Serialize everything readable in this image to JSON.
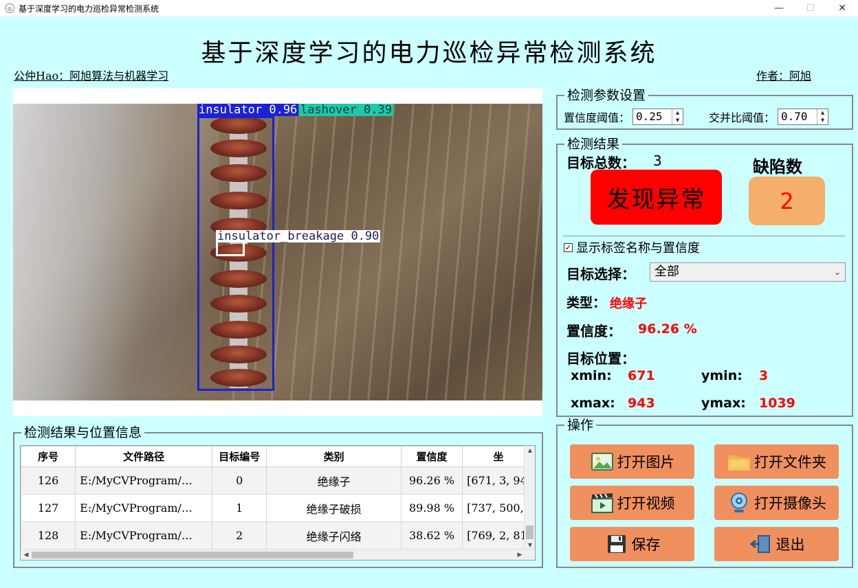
{
  "window": {
    "title": "基于深度学习的电力巡检异常检测系统"
  },
  "header": {
    "main_title": "基于深度学习的电力巡检异常检测系统",
    "left_note": "公仲Hao：阿旭算法与机器学习",
    "right_note": "作者：阿旭"
  },
  "image_view": {
    "detections": [
      {
        "label": "insulator 0.96",
        "color": "#1a22d6"
      },
      {
        "label": "lashover 0.39",
        "color": "#1cc9a8"
      },
      {
        "label": "insulator_breakage 0.90",
        "color": "#ffffff"
      }
    ]
  },
  "params": {
    "title": "检测参数设置",
    "conf_label": "置信度阈值：",
    "conf_value": "0.25",
    "iou_label": "交并比阈值：",
    "iou_value": "0.70"
  },
  "results": {
    "title": "检测结果",
    "total_label": "目标总数：",
    "total_value": "3",
    "defect_label": "缺陷数",
    "abnormal_text": "发现异常",
    "defect_value": "2",
    "show_labels_text": "显示标签名称与置信度",
    "target_select_label": "目标选择：",
    "target_select_value": "全部",
    "type_label": "类型：",
    "type_value": "绝缘子",
    "conf_label": "置信度：",
    "conf_value": "96.26 %",
    "pos_label": "目标位置：",
    "xmin_label": "xmin:",
    "xmin_value": "671",
    "ymin_label": "ymin:",
    "ymin_value": "3",
    "xmax_label": "xmax:",
    "xmax_value": "943",
    "ymax_label": "ymax:",
    "ymax_value": "1039"
  },
  "table": {
    "title": "检测结果与位置信息",
    "headers": [
      "序号",
      "文件路径",
      "目标编号",
      "类别",
      "置信度",
      "坐"
    ],
    "rows": [
      [
        "126",
        "E:/MyCVProgram/…",
        "0",
        "绝缘子",
        "96.26 %",
        "[671, 3, 94"
      ],
      [
        "127",
        "E:/MyCVProgram/…",
        "1",
        "绝缘子破损",
        "89.98 %",
        "[737, 500, 8"
      ],
      [
        "128",
        "E:/MyCVProgram/…",
        "2",
        "绝缘子闪络",
        "38.62 %",
        "[769, 2, 81"
      ]
    ]
  },
  "actions": {
    "title": "操作",
    "open_image": "打开图片",
    "open_folder": "打开文件夹",
    "open_video": "打开视频",
    "open_camera": "打开摄像头",
    "save": "保存",
    "exit": "退出"
  },
  "colors": {
    "background": "#ccffff",
    "abnormal": "#ff0000",
    "defect_box": "#f4b06b",
    "button": "#f0905e",
    "value_red": "#ff0000"
  }
}
